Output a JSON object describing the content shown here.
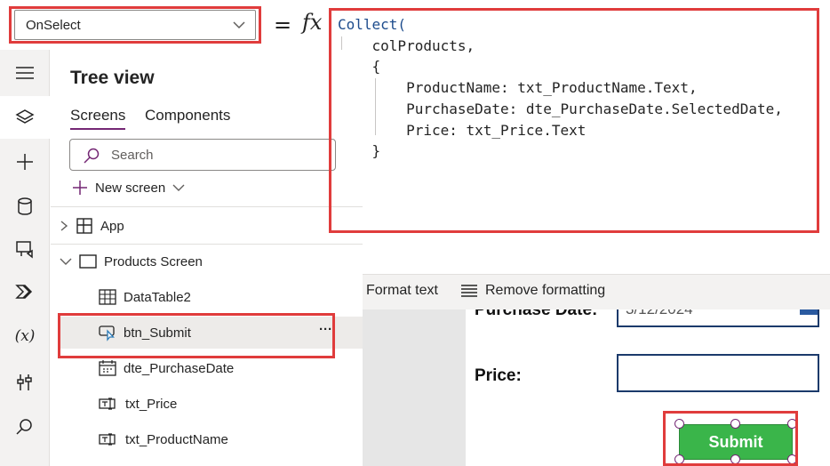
{
  "formula_bar": {
    "property": "OnSelect",
    "equals": "=",
    "fx": "fx"
  },
  "code": {
    "lines": [
      "Collect(",
      "    colProducts,",
      "    {",
      "        ProductName: txt_ProductName.Text,",
      "        PurchaseDate: dte_PurchaseDate.SelectedDate,",
      "        Price: txt_Price.Text",
      "    }",
      ")"
    ]
  },
  "format_bar": {
    "format_text": "Format text",
    "remove_formatting": "Remove formatting"
  },
  "rail": {
    "icons": [
      "hamburger-icon",
      "layers-icon",
      "plus-icon",
      "database-icon",
      "media-icon",
      "power-automate-icon",
      "variables-icon",
      "tools-icon",
      "search-icon"
    ],
    "variables_label": "(x)"
  },
  "tree": {
    "title": "Tree view",
    "tabs": [
      "Screens",
      "Components"
    ],
    "search_placeholder": "Search",
    "new_screen": "New screen",
    "nodes": {
      "app": "App",
      "screen": "Products Screen",
      "datatable": "DataTable2",
      "button": "btn_Submit",
      "datepicker": "dte_PurchaseDate",
      "price": "txt_Price",
      "productname": "txt_ProductName"
    },
    "more": "···"
  },
  "canvas": {
    "purchase_label": "Purchase Date:",
    "purchase_value": "3/12/2024",
    "price_label": "Price:",
    "submit_label": "Submit"
  },
  "colors": {
    "accent": "#742774",
    "highlight": "#e03c3c",
    "submit_green": "#3ab54a",
    "input_border": "#1b3a6b"
  }
}
